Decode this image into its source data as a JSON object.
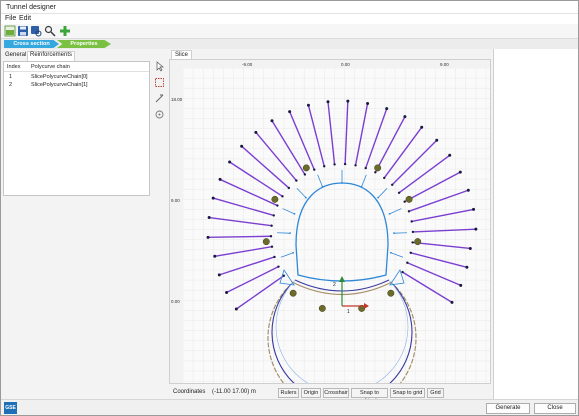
{
  "window": {
    "title": "Tunnel designer"
  },
  "menu": {
    "file": "File",
    "edit": "Edit"
  },
  "steps": {
    "cross_section": "Cross section",
    "properties": "Properties"
  },
  "left_panel": {
    "tabs": {
      "general": "General",
      "reinforcements": "Reinforcements"
    },
    "columns": {
      "index": "Index",
      "polycurve": "Polycurve chain"
    },
    "rows": [
      {
        "index": "1",
        "name": "SlicePolycurveChain[0]"
      },
      {
        "index": "2",
        "name": "SlicePolycurveChain[1]"
      }
    ]
  },
  "view": {
    "tab": "Slice",
    "top_ruler": [
      "-9.00",
      "0.00",
      "9.00"
    ],
    "left_ruler": [
      "18.00",
      "9.00",
      "0.00"
    ],
    "axis_labels": {
      "origin": "1",
      "y": "2"
    }
  },
  "status": {
    "coordinates_label": "Coordinates",
    "coordinates_value": "(-11.00 17.00) m",
    "buttons": [
      "Rulers",
      "Origin",
      "Crosshair",
      "Snap to object",
      "Snap to grid",
      "Grid"
    ]
  },
  "footer": {
    "logo": "GSE",
    "generate": "Generate",
    "close": "Close"
  },
  "colors": {
    "bolt": "#7b3fd1",
    "lining": "#2f87d8",
    "accent_green": "#7ac143",
    "accent_blue": "#35a8e0"
  }
}
